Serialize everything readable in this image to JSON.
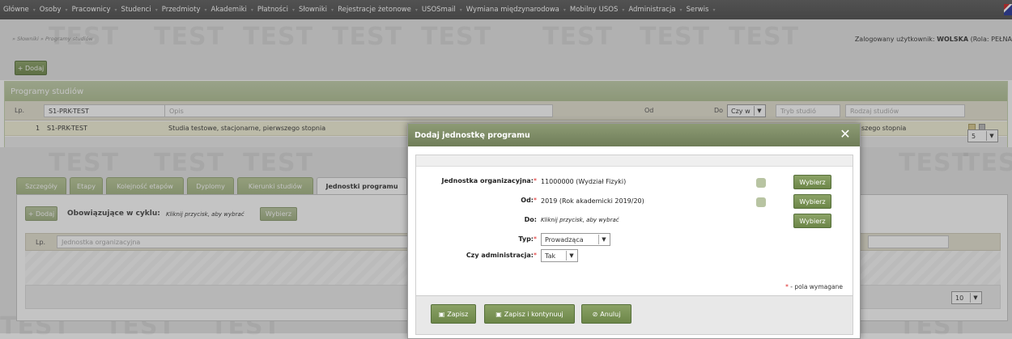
{
  "menu": [
    "Główne",
    "Osoby",
    "Pracownicy",
    "Studenci",
    "Przedmioty",
    "Akademiki",
    "Płatności",
    "Słowniki",
    "Rejestracje żetonowe",
    "USOSmail",
    "Wymiana międzynarodowa",
    "Mobilny USOS",
    "Administracja",
    "Serwis"
  ],
  "watermark": "TEST",
  "breadcrumb": "» Słowniki » Programy studiów",
  "login": {
    "prefix": "Zalogowany użytkownik: ",
    "user": "WOLSKA",
    "suffix": " (Rola: PEŁNA"
  },
  "add_button": "+ Dodaj",
  "panel": {
    "title": "Programy studiów",
    "lp_header": "Lp.",
    "filter_code": "S1-PRK-TEST",
    "filter_opis": "Opis",
    "col_od": "Od",
    "col_do": "Do",
    "czy_select": "Czy w",
    "filter_tryb": "Tryb studió",
    "filter_rodzaj": "Rodzaj studiów",
    "row": {
      "num": "1",
      "code": "S1-PRK-TEST",
      "opis": "Studia testowe, stacjonarne, pierwszego stopnia",
      "rodzaj": "szego stopnia"
    },
    "page_size": "5"
  },
  "tabs": [
    "Szczegóły",
    "Etapy",
    "Kolejność etapów",
    "Dyplomy",
    "Kierunki studiów",
    "Jednostki programu"
  ],
  "tab_content": {
    "add": "+ Dodaj",
    "cycle_label": "Obowiązujące w cyklu:",
    "cycle_hint": "Kliknij przycisk, aby wybrać",
    "choose": "Wybierz",
    "lp": "Lp.",
    "filter_unit": "Jednostka organizacyjna",
    "page_size": "10"
  },
  "modal": {
    "title": "Dodaj jednostkę programu",
    "fields": {
      "unit_label": "Jednostka organizacyjna:",
      "unit_value": "11000000 (Wydział Fizyki)",
      "od_label": "Od:",
      "od_value": "2019 (Rok akademicki 2019/20)",
      "do_label": "Do:",
      "do_value": "Kliknij przycisk, aby wybrać",
      "typ_label": "Typ:",
      "typ_value": "Prowadząca",
      "admin_label": "Czy administracja:",
      "admin_value": "Tak"
    },
    "choose": "Wybierz",
    "required_mark": "*",
    "required_note": " - pola wymagane",
    "save": "Zapisz",
    "save_continue": "Zapisz i kontynuuj",
    "cancel": "Anuluj"
  }
}
